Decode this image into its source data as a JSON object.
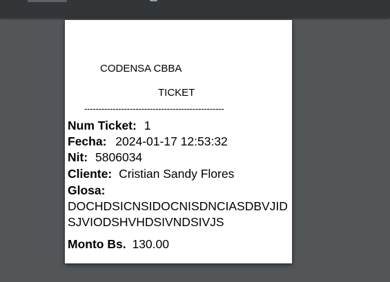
{
  "viewer": {
    "background": "#525659",
    "toolbar_color": "#323639"
  },
  "ticket": {
    "company": "CODENSA CBBA",
    "title": "TICKET",
    "divider": "-------------------------------------------------",
    "num_ticket_label": "Num Ticket:",
    "num_ticket_value": "1",
    "fecha_label": "Fecha:",
    "fecha_value": "2024-01-17 12:53:32",
    "nit_label": "Nit:",
    "nit_value": "5806034",
    "cliente_label": "Cliente:",
    "cliente_value": "Cristian Sandy Flores",
    "glosa_label": "Glosa:",
    "glosa_value": "DOCHDSICNSIDOCNISDNCIASDBVJIDSJVIODSHVHDSIVNDSIVJS",
    "monto_label": "Monto Bs.",
    "monto_value": "130.00"
  }
}
